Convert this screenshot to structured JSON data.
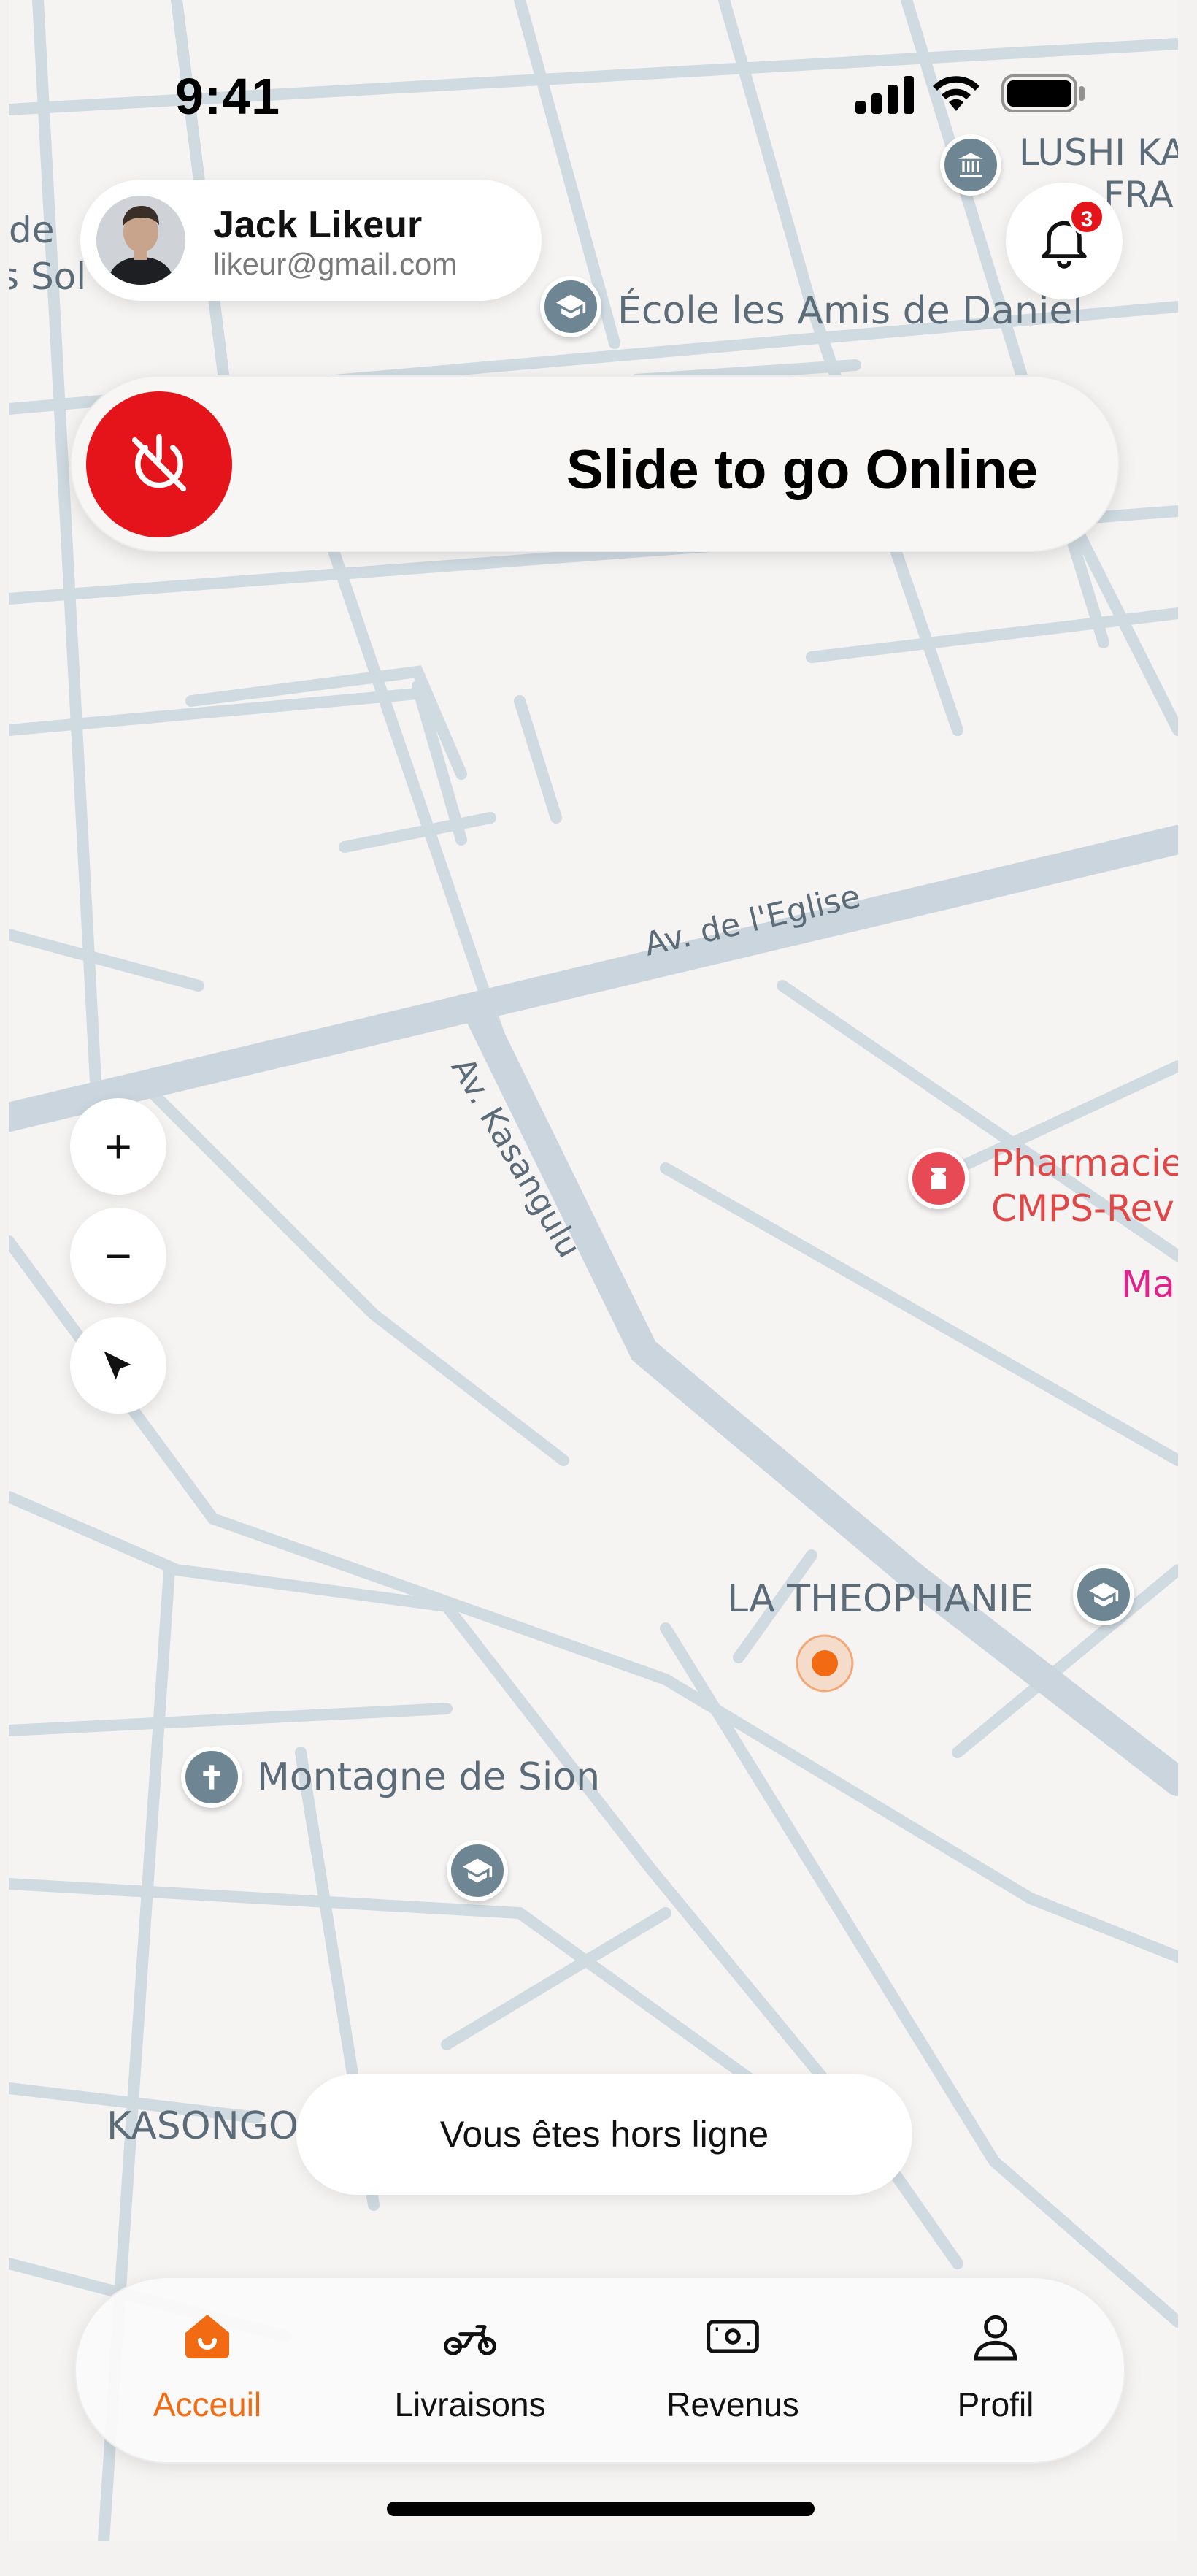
{
  "status_bar": {
    "time": "9:41"
  },
  "profile": {
    "name": "Jack Likeur",
    "email": "likeur@gmail.com"
  },
  "notifications": {
    "count": "3"
  },
  "slider": {
    "label": "Slide to go Online"
  },
  "map": {
    "labels": {
      "poi_top_right": "LUSHI KA",
      "poi_top_right_2": "FRA",
      "school_daniel": "École les Amis de Daniel",
      "left_edge_1": "de",
      "left_edge_2": "s Sol",
      "street_eglise": "Av. de l'Eglise",
      "street_kasangulu": "Av. Kasangulu",
      "pharmacy_1": "Pharmacie",
      "pharmacy_2": "CMPS-Rev",
      "pink_label": "Ma",
      "theophanie": "LA THEOPHANIE",
      "montagne": "Montagne de Sion",
      "kasongo": "KASONGO"
    },
    "controls": {
      "zoom_in": "+",
      "zoom_out": "−"
    }
  },
  "status_toast": "Vous êtes hors ligne",
  "nav": {
    "items": [
      {
        "label": "Acceuil",
        "icon": "home-icon",
        "active": true
      },
      {
        "label": "Livraisons",
        "icon": "motorbike-icon",
        "active": false
      },
      {
        "label": "Revenus",
        "icon": "money-icon",
        "active": false
      },
      {
        "label": "Profil",
        "icon": "user-icon",
        "active": false
      }
    ]
  },
  "colors": {
    "accent": "#F26A12",
    "danger": "#E5141B",
    "road": "#C8D4DC",
    "map_bg": "#F5F4F3"
  }
}
